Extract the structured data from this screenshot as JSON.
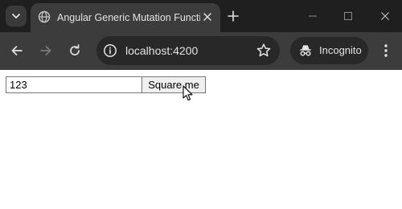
{
  "browser": {
    "tab": {
      "title": "Angular Generic Mutation Function",
      "favicon": "globe-icon"
    },
    "address_bar": {
      "url": "localhost:4200"
    },
    "incognito_label": "Incognito"
  },
  "page": {
    "input_value": "123",
    "button_label": "Square me"
  },
  "colors": {
    "tabstrip": "#1f1f1f",
    "toolbar": "#3c3c3c",
    "omnibox": "#282828",
    "text": "#e3e3e3"
  }
}
